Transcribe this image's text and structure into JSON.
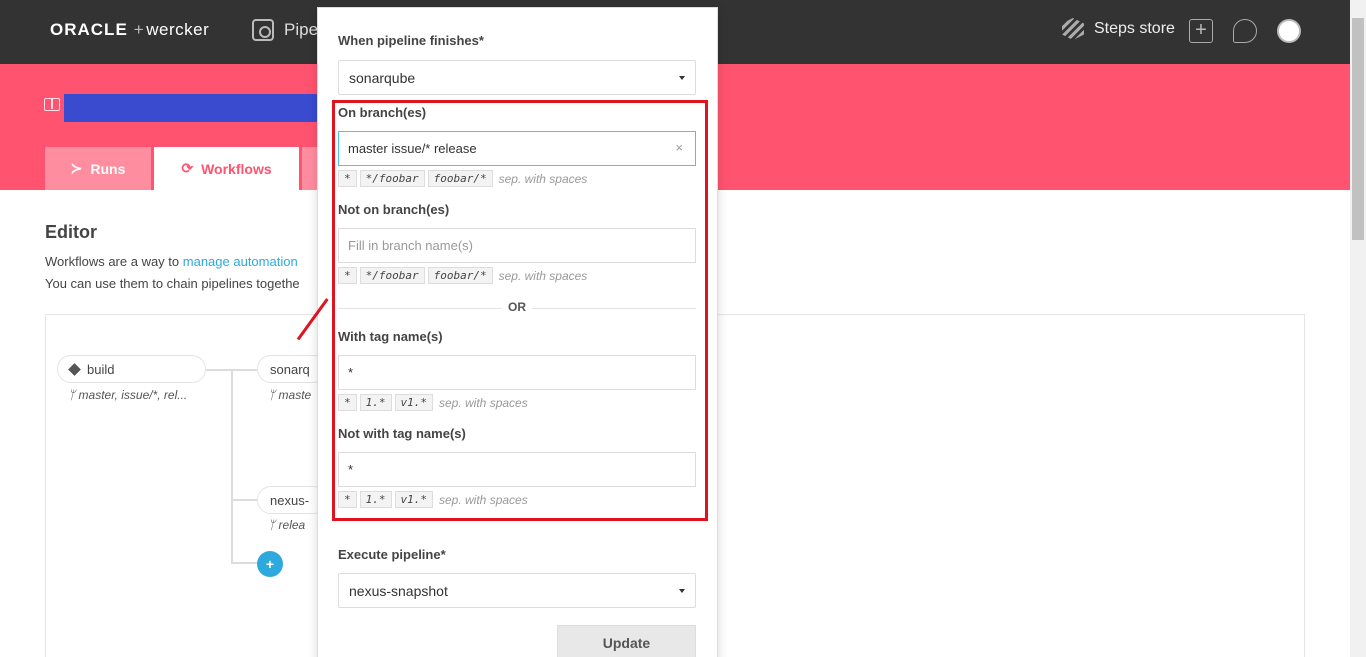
{
  "header": {
    "brand_oracle": "ORACLE",
    "brand_plus": "+",
    "brand_wercker": "wercker",
    "nav_pipelines": "Pipe",
    "steps_store": "Steps store"
  },
  "tabs": {
    "runs": "Runs",
    "workflows": "Workflows"
  },
  "page": {
    "title": "Editor",
    "desc1_prefix": "Workflows are a way to ",
    "desc1_link": "manage automation",
    "desc2": "You can use them to chain pipelines togethe"
  },
  "workflow": {
    "build": {
      "name": "build",
      "branches": "master, issue/*, rel..."
    },
    "sonar": {
      "name": "sonarq",
      "branches": "maste"
    },
    "nexus": {
      "name": "nexus-",
      "branches": "relea"
    },
    "add": "+"
  },
  "modal": {
    "when_label": "When pipeline finishes*",
    "when_value": "sonarqube",
    "on_branch_label": "On branch(es)",
    "on_branch_value": "master issue/* release",
    "clear": "×",
    "not_on_branch_label": "Not on branch(es)",
    "not_on_branch_placeholder": "Fill in branch name(s)",
    "branch_hints": [
      "*",
      "*/foobar",
      "foobar/*"
    ],
    "sep_text": "sep. with spaces",
    "or": "OR",
    "with_tag_label": "With tag name(s)",
    "with_tag_value": "*",
    "tag_hints": [
      "*",
      "1.*",
      "v1.*"
    ],
    "not_with_tag_label": "Not with tag name(s)",
    "not_with_tag_value": "*",
    "execute_label": "Execute pipeline*",
    "execute_value": "nexus-snapshot",
    "update_button": "Update"
  }
}
